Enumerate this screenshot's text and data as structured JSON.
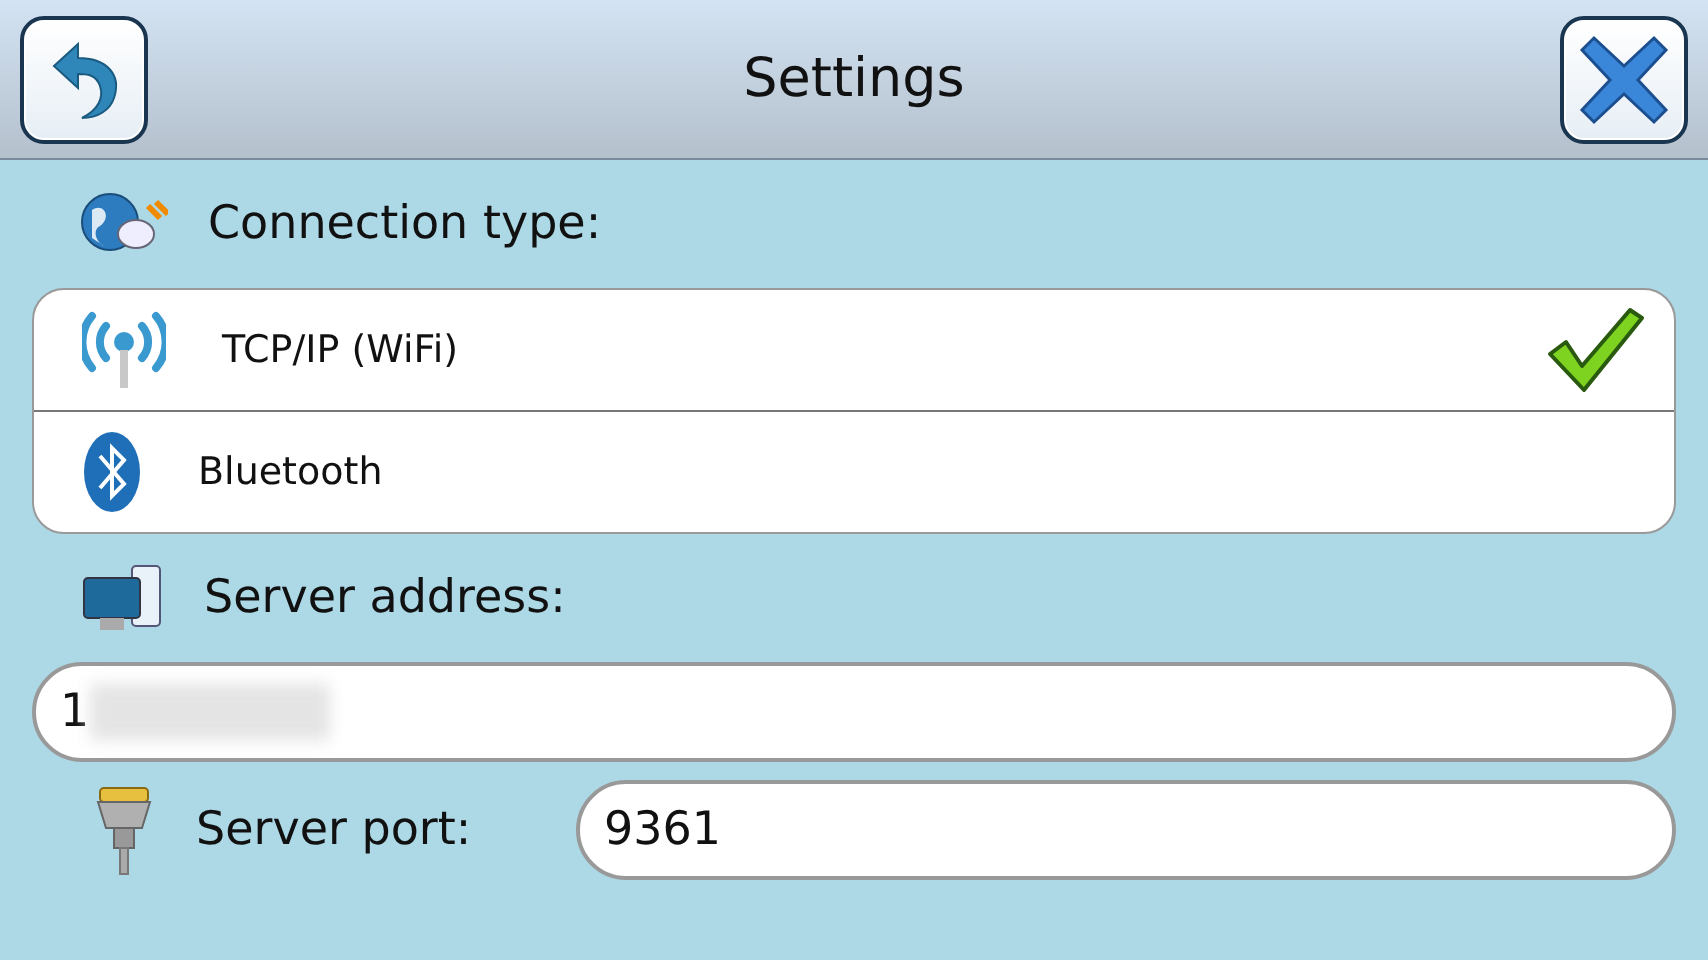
{
  "header": {
    "title": "Settings"
  },
  "connection": {
    "label": "Connection type:",
    "options": [
      {
        "kind": "wifi",
        "label": "TCP/IP (WiFi)",
        "selected": true
      },
      {
        "kind": "bluetooth",
        "label": "Bluetooth",
        "selected": false
      }
    ]
  },
  "server_address": {
    "label": "Server address:",
    "value": "1"
  },
  "server_port": {
    "label": "Server port:",
    "value": "9361"
  }
}
